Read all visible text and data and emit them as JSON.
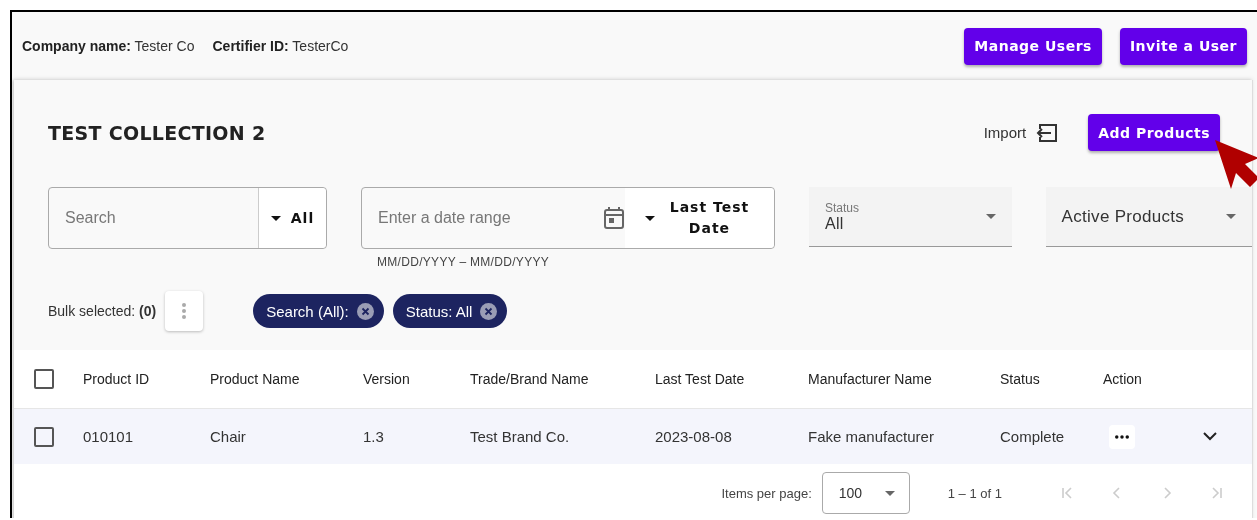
{
  "header": {
    "company_label": "Company name:",
    "company_value": "Tester Co",
    "certifier_label": "Certifier ID:",
    "certifier_value": "TesterCo",
    "buttons": [
      "Manage Users",
      "Invite a User"
    ]
  },
  "collection": {
    "title": "TEST COLLECTION 2",
    "import_label": "Import",
    "add_button": "Add Products"
  },
  "filters": {
    "search": {
      "placeholder": "Search",
      "scope": "All"
    },
    "date_range": {
      "placeholder": "Enter a date range",
      "hint": "MM/DD/YYYY – MM/DD/YYYY",
      "field": "Last Test Date"
    },
    "status": {
      "label": "Status",
      "value": "All"
    },
    "product_filter": {
      "value": "Active Products"
    }
  },
  "bulk": {
    "label": "Bulk selected: **(0)**"
  },
  "chips": [
    "Search (All):",
    "Status: All"
  ],
  "table": {
    "select_all": {
      "checked": false
    },
    "columns": [
      "Product ID",
      "Product Name",
      "Version",
      "Trade/Brand Name",
      "Last Test Date",
      "Manufacturer Name",
      "Status",
      "Action"
    ],
    "rows": [
      {
        "checked": false,
        "expanded": false,
        "cells": [
          "010101",
          "Chair",
          "1.3",
          "Test Brand Co.",
          "2023-08-08",
          "Fake manufacturer",
          "Complete"
        ]
      }
    ]
  },
  "pagination": {
    "items_label": "Items per page:",
    "page_size": "100",
    "range": "1 – 1 of 1",
    "disabled": true
  }
}
